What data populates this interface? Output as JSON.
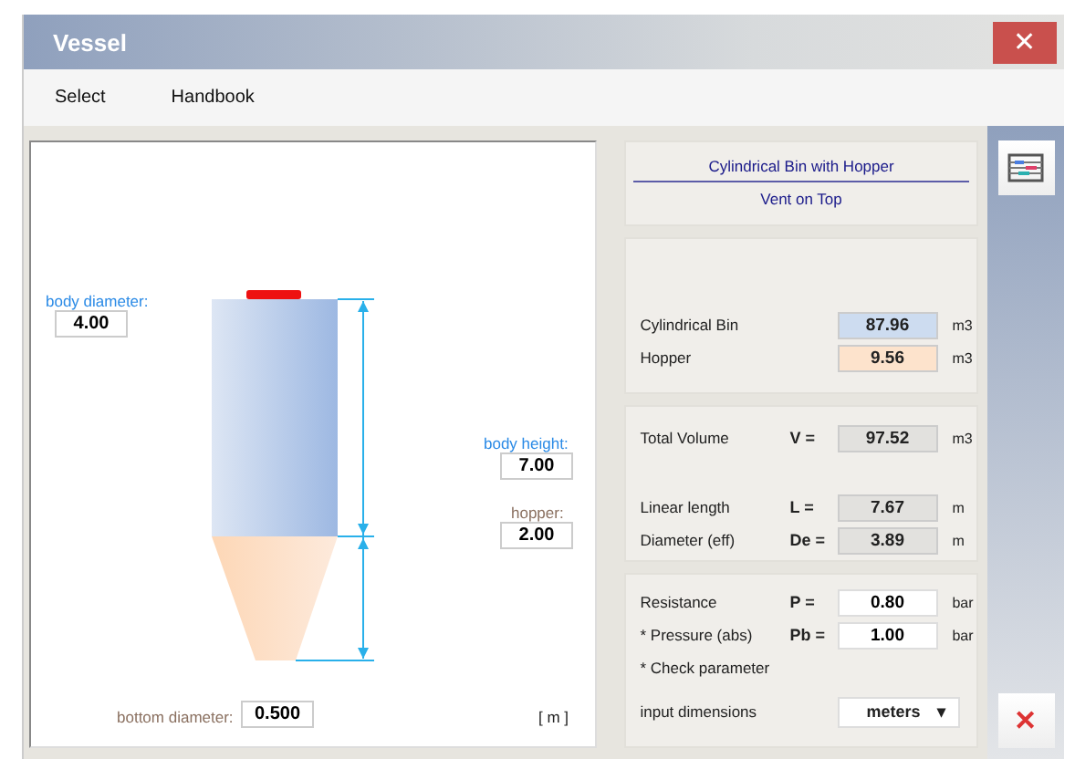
{
  "window": {
    "title": "Vessel",
    "close": "✕"
  },
  "menu": [
    "Select",
    "Handbook"
  ],
  "drawing": {
    "fields": [
      {
        "kind": "body_diameter",
        "label": "body diameter:",
        "value": "4.00"
      },
      {
        "kind": "body_height",
        "label": "body height:",
        "value": "7.00"
      },
      {
        "kind": "hopper",
        "label": "hopper:",
        "value": "2.00"
      },
      {
        "kind": "bottom_diameter",
        "label": "bottom diameter:",
        "value": "0.500"
      }
    ],
    "unit": "[ m ]"
  },
  "header": {
    "title": "Cylindrical Bin with Hopper",
    "subtitle": "Vent on Top"
  },
  "volumes": [
    {
      "label": "Cylindrical Bin",
      "value": "87.96",
      "unit": "m3",
      "color": "#cddcf0"
    },
    {
      "label": "Hopper",
      "value": "9.56",
      "unit": "m3",
      "color": "#fde3cc"
    }
  ],
  "results": [
    [
      {
        "label": "Total Volume",
        "symbol": "V =",
        "value": "97.52",
        "unit": "m3"
      }
    ],
    [
      {
        "label": "Linear length",
        "symbol": "L =",
        "value": "7.67",
        "unit": "m"
      },
      {
        "label": "Diameter (eff)",
        "symbol": "De =",
        "value": "3.89",
        "unit": "m"
      }
    ]
  ],
  "parameters": [
    {
      "kind": "input",
      "label": "Resistance",
      "symbol": "P =",
      "value": "0.80",
      "unit": "bar"
    },
    {
      "kind": "input",
      "label": "* Pressure (abs)",
      "symbol": "Pb =",
      "value": "1.00",
      "unit": "bar"
    },
    {
      "kind": "note",
      "label": "* Check parameter"
    },
    {
      "kind": "select",
      "label": "input dimensions",
      "value": "meters",
      "caret": "▾"
    }
  ],
  "sidebar": {
    "close": "✕"
  }
}
